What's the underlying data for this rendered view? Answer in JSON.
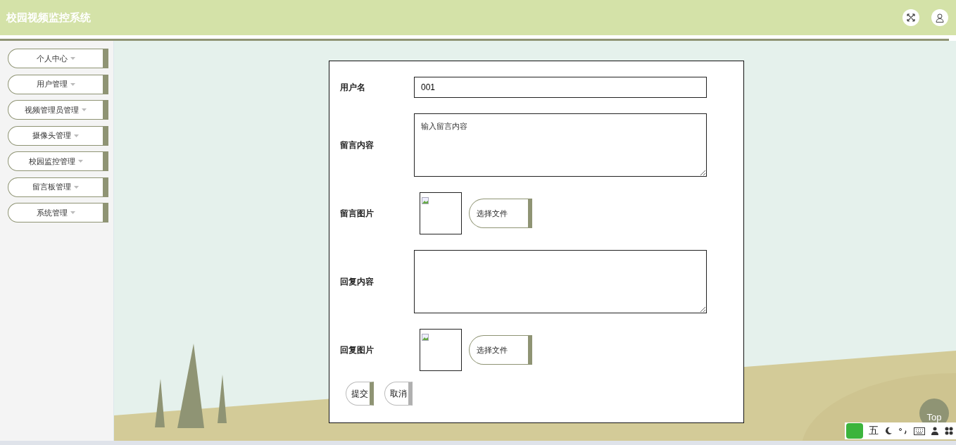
{
  "header": {
    "title": "校园视频监控系统"
  },
  "sidebar": {
    "items": [
      {
        "label": "个人中心"
      },
      {
        "label": "用户管理"
      },
      {
        "label": "视频管理员管理"
      },
      {
        "label": "摄像头管理"
      },
      {
        "label": "校园监控管理"
      },
      {
        "label": "留言板管理"
      },
      {
        "label": "系统管理"
      }
    ]
  },
  "form": {
    "fields": [
      {
        "kind": "text",
        "label": "用户名",
        "value": "001"
      },
      {
        "kind": "textarea",
        "label": "留言内容",
        "placeholder": "输入留言内容"
      },
      {
        "kind": "image",
        "label": "留言图片",
        "button": "选择文件"
      },
      {
        "kind": "textarea",
        "label": "回复内容"
      },
      {
        "kind": "image",
        "label": "回复图片",
        "button": "选择文件"
      }
    ],
    "buttons": [
      {
        "kind": "primary",
        "label": "提交"
      },
      {
        "kind": "secondary",
        "label": "取消"
      }
    ]
  },
  "top_button": "Top",
  "ime_toolbar": {
    "mode": "五"
  }
}
